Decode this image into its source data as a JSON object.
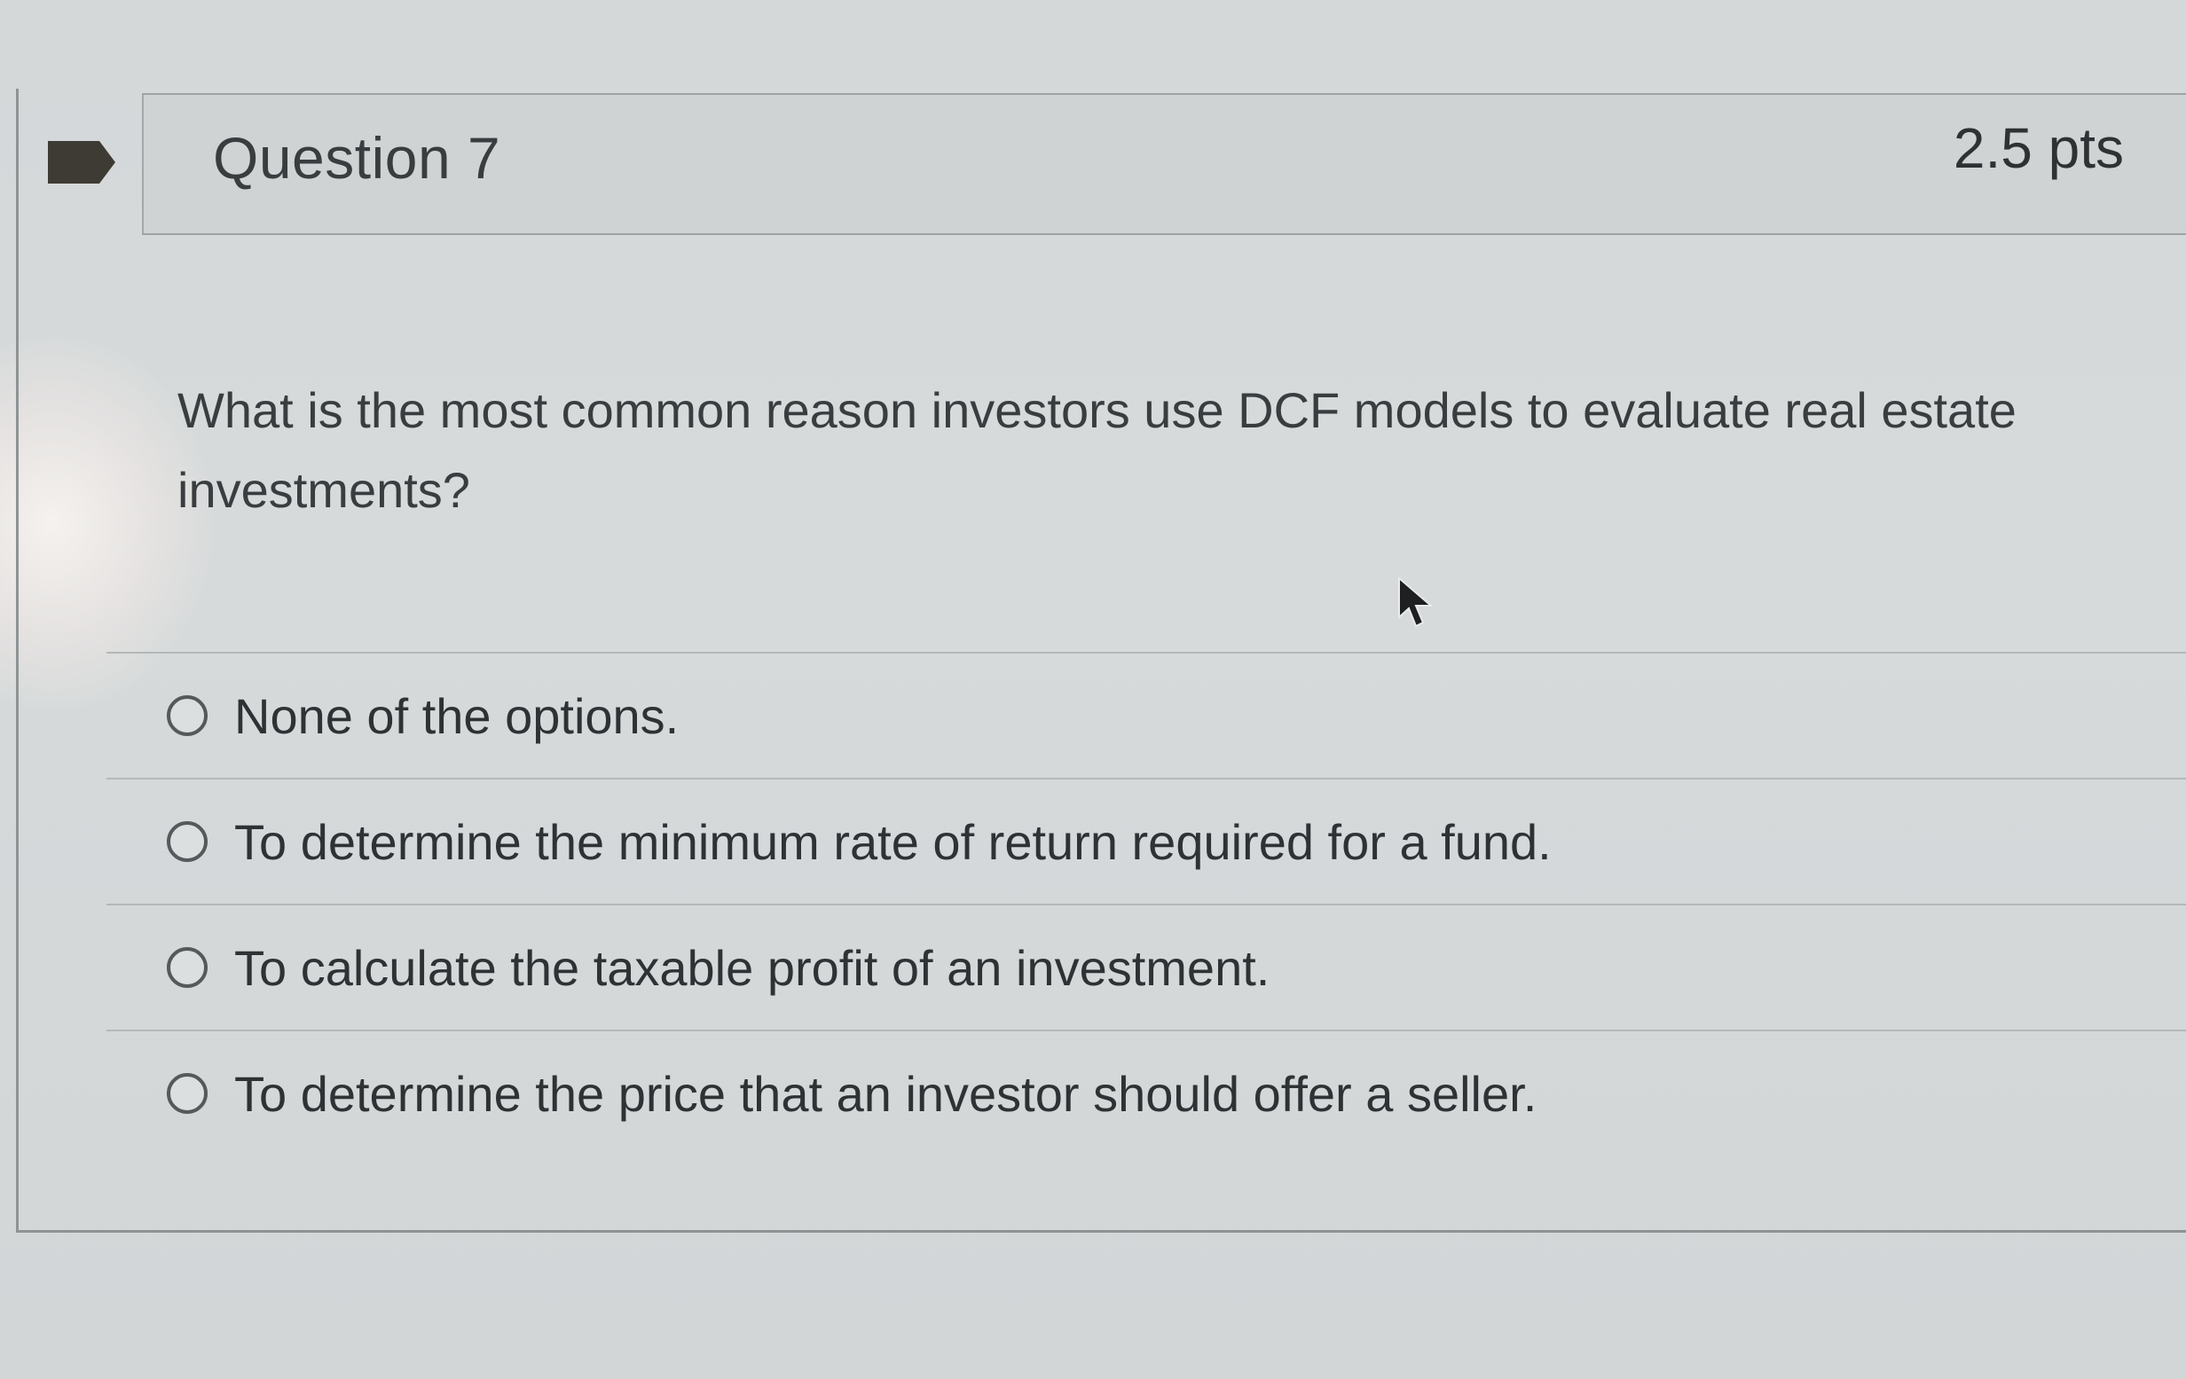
{
  "question": {
    "title": "Question 7",
    "points": "2.5 pts",
    "text": "What is the most common reason investors use DCF models to evaluate real estate investments?"
  },
  "answers": [
    {
      "label": "None of the options.",
      "selected": false
    },
    {
      "label": "To determine the minimum rate of return required for a fund.",
      "selected": false
    },
    {
      "label": "To calculate the taxable profit of an investment.",
      "selected": false
    },
    {
      "label": "To determine the price that an investor should offer a seller.",
      "selected": false
    }
  ],
  "icons": {
    "flag": "flag-icon",
    "cursor": "mouse-cursor-icon"
  },
  "colors": {
    "flag": "#3d3b33",
    "text": "#2f3235",
    "background": "#d4d8d9"
  }
}
